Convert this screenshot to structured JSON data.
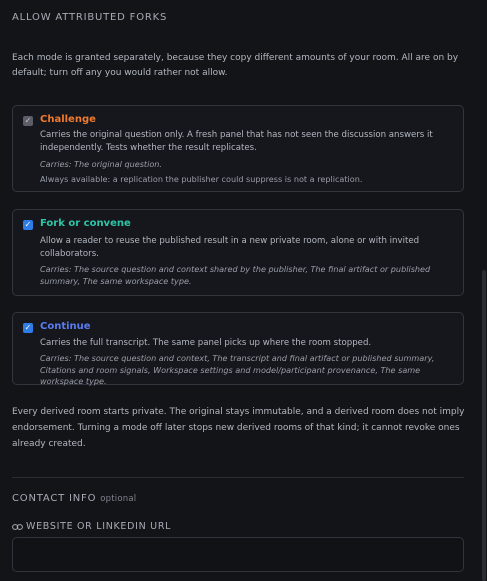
{
  "forks": {
    "heading": "ALLOW ATTRIBUTED FORKS",
    "intro": "Each mode is granted separately, because they copy different amounts of your room. All are on by default; turn off any you would rather not allow.",
    "modes": [
      {
        "title": "Challenge",
        "title_color": "#f07a2e",
        "checked": true,
        "disabled": true,
        "description": "Carries the original question only. A fresh panel that has not seen the discussion answers it independently. Tests whether the result replicates.",
        "carries": "Carries: The original question.",
        "note": "Always available: a replication the publisher could suppress is not a replication."
      },
      {
        "title": "Fork or convene",
        "title_color": "#2ec5a6",
        "checked": true,
        "disabled": false,
        "description": "Allow a reader to reuse the published result in a new private room, alone or with invited collaborators.",
        "carries": "Carries: The source question and context shared by the publisher, The final artifact or published summary, The same workspace type."
      },
      {
        "title": "Continue",
        "title_color": "#5b7cf2",
        "checked": true,
        "disabled": false,
        "description": "Carries the full transcript. The same panel picks up where the room stopped.",
        "carries": "Carries: The source question and context, The transcript and final artifact or published summary, Citations and room signals, Workspace settings and model/participant provenance, The same workspace type."
      }
    ],
    "footnote": "Every derived room starts private. The original stays immutable, and a derived room does not imply endorsement. Turning a mode off later stops new derived rooms of that kind; it cannot revoke ones already created."
  },
  "contact": {
    "heading": "CONTACT INFO",
    "optional_label": "optional",
    "url_label": "WEBSITE OR LINKEDIN URL",
    "url_value": "",
    "url_icon": "link-icon"
  },
  "colors": {
    "background": "#121418",
    "card_border": "#32353d",
    "checkbox_checked": "#2f7be8"
  }
}
